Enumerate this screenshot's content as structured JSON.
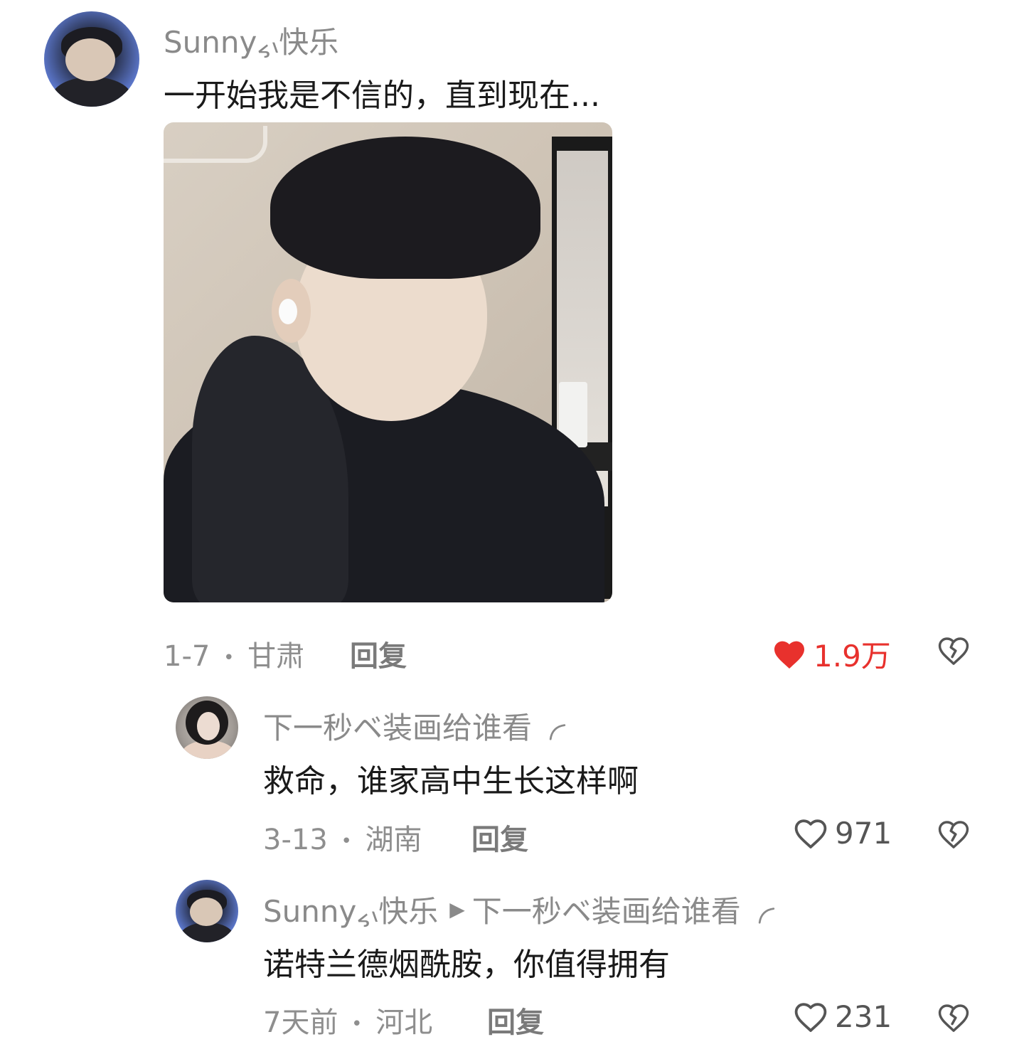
{
  "main_comment": {
    "username": "Sunny៹៶快乐",
    "text": "一开始我是不信的，直到现在...",
    "date": "1-7",
    "location": "甘肃",
    "separator": "•",
    "reply_label": "回复",
    "likes": "1.9万",
    "liked": true
  },
  "replies": [
    {
      "username": "下一秒ベ装画给谁看",
      "text": "救命，谁家高中生长这样啊",
      "date": "3-13",
      "location": "湖南",
      "separator": "•",
      "reply_label": "回复",
      "likes": "971",
      "liked": false
    },
    {
      "username": "Sunny៹៶快乐",
      "reply_arrow": "▶",
      "reply_to": "下一秒ベ装画给谁看",
      "text": "诺特兰德烟酰胺，你值得拥有",
      "date": "7天前",
      "location": "河北",
      "separator": "•",
      "reply_label": "回复",
      "likes": "231",
      "liked": false
    }
  ],
  "colors": {
    "like_active": "#e8312d",
    "text_gray": "#8a8a8a",
    "text_dark": "#1a1a1a"
  },
  "icons": {
    "like": "heart-icon",
    "dislike": "broken-heart-icon",
    "reply_to": "play-triangle-icon"
  }
}
